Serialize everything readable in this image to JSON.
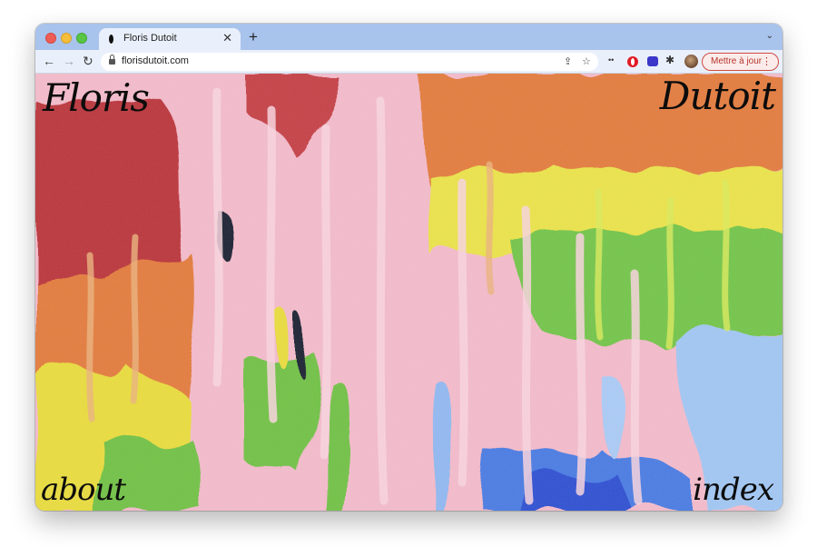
{
  "browser": {
    "tab": {
      "title": "Floris Dutoit",
      "close_label": "✕"
    },
    "new_tab_label": "+",
    "tab_menu_label": "⌄",
    "nav": {
      "back": "←",
      "forward": "→",
      "reload": "↻"
    },
    "address": {
      "url": "florisdutoit.com"
    },
    "share_label": "⇪",
    "bookmark_label": "☆",
    "ext_key_label": "••",
    "puzzle_label": "✱",
    "update_button": {
      "label": "Mettre à jour",
      "more": "⋮"
    }
  },
  "site": {
    "title_left": "Floris",
    "title_right": "Dutoit",
    "nav_about": "about",
    "nav_index": "index"
  },
  "colors": {
    "tabstrip": "#a8c3ec",
    "toolbar": "#eaf0fb",
    "update_accent": "#cf4b3f",
    "paint_pink": "#f0b8c8",
    "paint_red": "#b8343a",
    "paint_orange": "#e07a3e",
    "paint_yellow": "#e8e04a",
    "paint_green": "#72c24a",
    "paint_blue": "#4a7ae0"
  }
}
